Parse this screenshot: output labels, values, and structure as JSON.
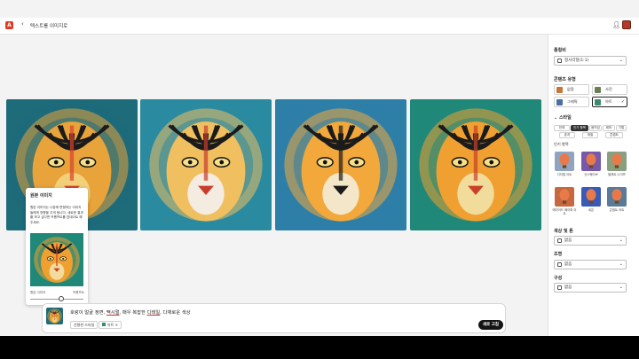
{
  "app": {
    "logo_letter": "A",
    "title": "텍스트를 이미지로",
    "back_icon": "chevron-left-icon"
  },
  "images": [
    {
      "name": "generated-image-1",
      "palette": [
        "#e8a33a",
        "#1e6c7a",
        "#d9412e",
        "#f2d07a"
      ]
    },
    {
      "name": "generated-image-2",
      "palette": [
        "#f0c060",
        "#2a8aa0",
        "#c83c2e",
        "#f4ece0"
      ]
    },
    {
      "name": "generated-image-3",
      "palette": [
        "#f2a83a",
        "#2d7fa8",
        "#1b1b1b",
        "#f4e6c8"
      ]
    },
    {
      "name": "generated-image-4",
      "palette": [
        "#f0a030",
        "#208878",
        "#c8402a",
        "#f2dc9c"
      ]
    }
  ],
  "popover": {
    "title": "원본 이미지",
    "description": "원본 이미지는 나중에 변형하는 이미지들에게 영향을 주게 됩니다. 새로운 결과를 보고 싶다면 프롬프트를 업데이트 해주세요.",
    "slider_min": "원본 이미지",
    "slider_max": "프롬프트"
  },
  "prompt": {
    "text_parts": [
      "호랑이 얼굴 정면, ",
      "맥시멀",
      ", 매우 복잡한 ",
      "디테일",
      ", 다채로운 색상"
    ],
    "btn_style": "선명한 스타일",
    "btn_content": "아트",
    "refresh_label": "새로 고침"
  },
  "panel": {
    "aspect_label": "종횡비",
    "aspect_value": "정사각형(1:1)",
    "content_label": "콘텐츠 유형",
    "content_types": [
      {
        "label": "없음",
        "color": "#c4773a",
        "selected": false
      },
      {
        "label": "사진",
        "color": "#6a7f55",
        "selected": false
      },
      {
        "label": "그래픽",
        "color": "#4a6fa0",
        "selected": false
      },
      {
        "label": "아트",
        "color": "#3a8a70",
        "selected": true
      }
    ],
    "style_label": "스타일",
    "style_tabs": [
      "전체",
      "인기 항목",
      "움직임",
      "테마",
      "기법",
      "효과",
      "재질",
      "콘셉트"
    ],
    "style_tab_selected": "인기 항목",
    "effects_label": "인기 항목",
    "effects": [
      {
        "label": "디지털 아트",
        "color": "#8fa4c0"
      },
      {
        "label": "신스웨이브",
        "color": "#7858a8"
      },
      {
        "label": "팔레트 나이프",
        "color": "#88a080"
      },
      {
        "label": "레이어드 페이퍼 아트",
        "color": "#c86840"
      },
      {
        "label": "네온",
        "color": "#3a5ab8"
      },
      {
        "label": "콘셉트 아트",
        "color": "#5a7a98"
      }
    ],
    "color_tone_label": "색상 및 톤",
    "color_tone_value": "없음",
    "lighting_label": "조명",
    "lighting_value": "없음",
    "composition_label": "구성",
    "composition_value": "없음"
  },
  "colors": {
    "accent_red": "#e03a25",
    "button_dark": "#141414"
  }
}
